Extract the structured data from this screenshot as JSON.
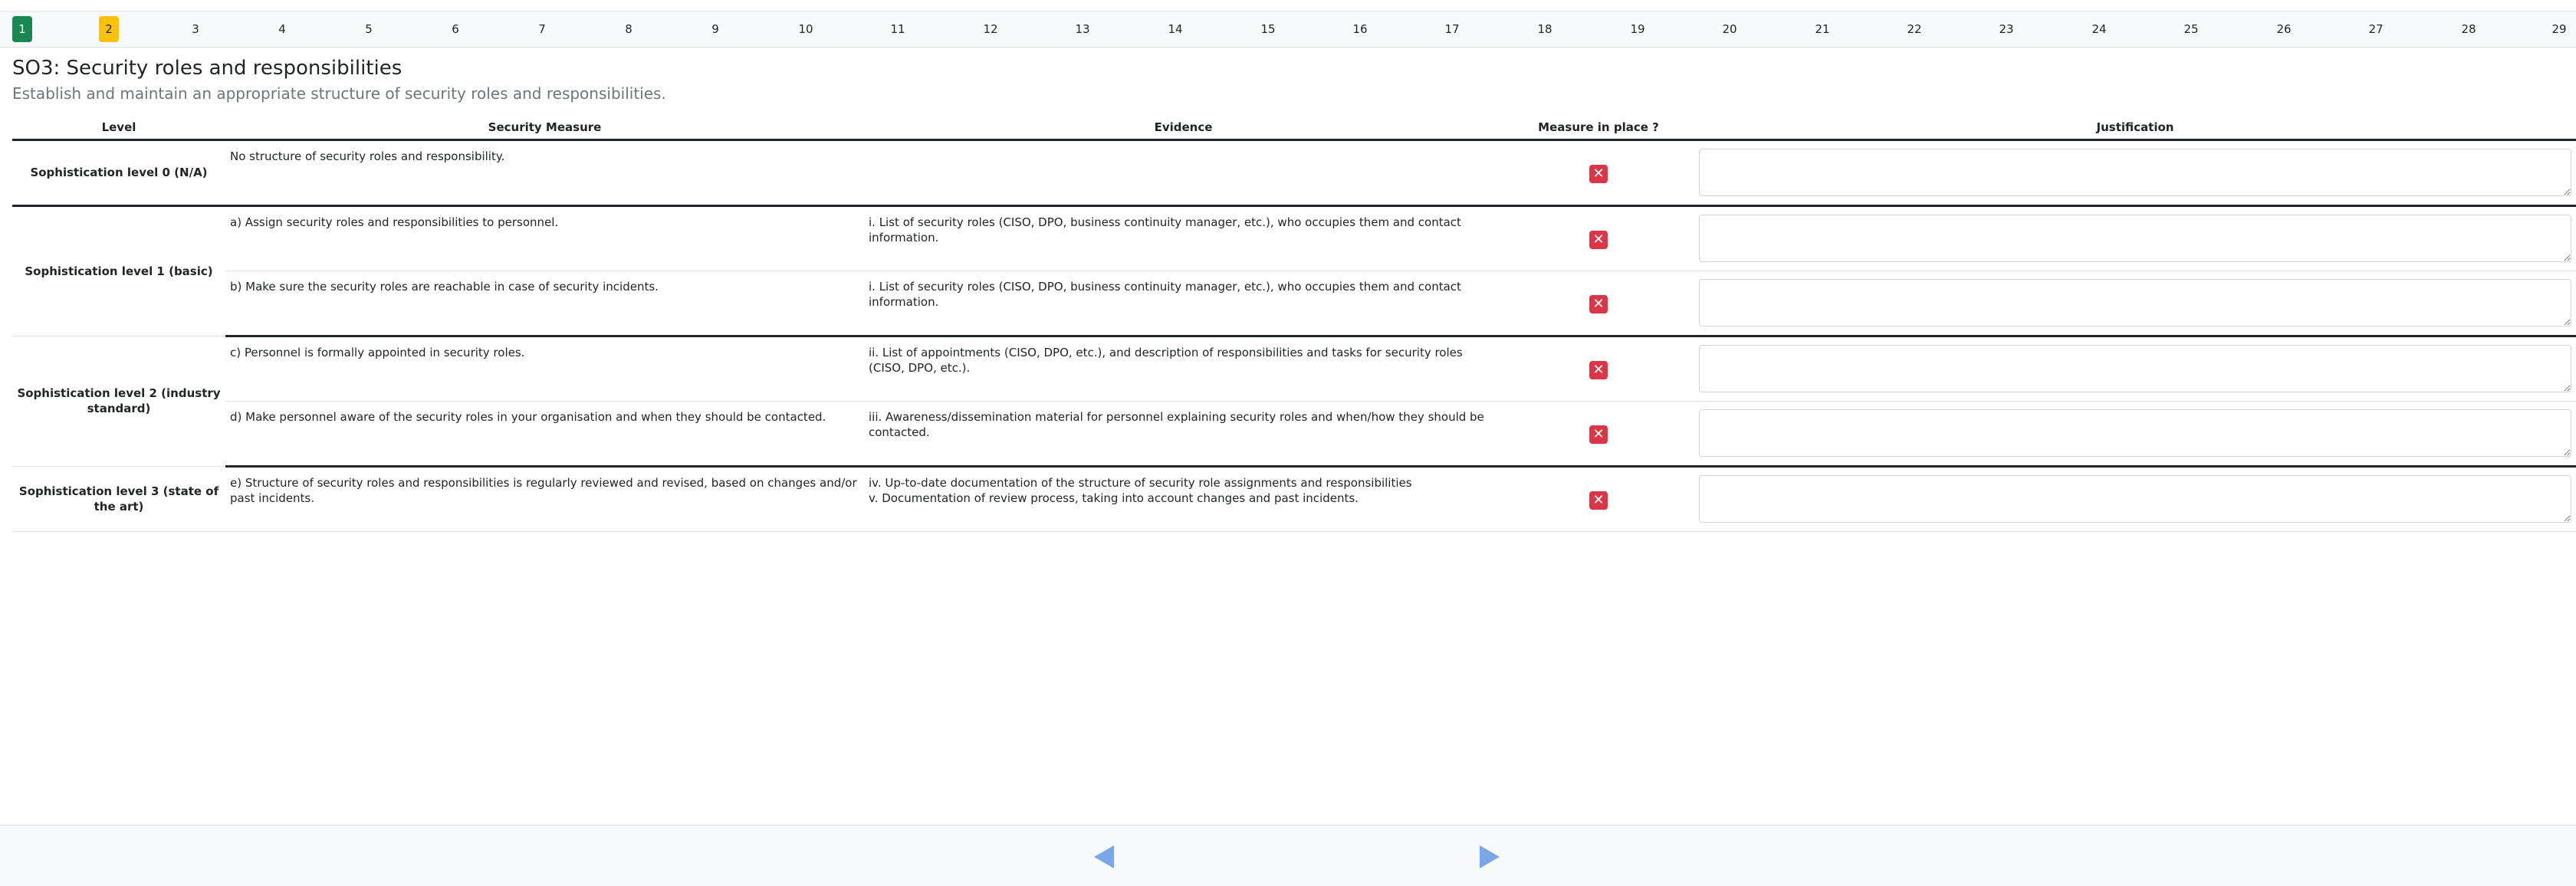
{
  "steps": {
    "items": [
      "1",
      "2",
      "3",
      "4",
      "5",
      "6",
      "7",
      "8",
      "9",
      "10",
      "11",
      "12",
      "13",
      "14",
      "15",
      "16",
      "17",
      "18",
      "19",
      "20",
      "21",
      "22",
      "23",
      "24",
      "25",
      "26",
      "27",
      "28",
      "29"
    ],
    "done_index": 0,
    "current_index": 1
  },
  "header": {
    "title": "SO3: Security roles and responsibilities",
    "subtitle": "Establish and maintain an appropriate structure of security roles and responsibilities."
  },
  "table": {
    "columns": {
      "level": "Level",
      "measure": "Security Measure",
      "evidence": "Evidence",
      "in_place": "Measure in place ?",
      "justification": "Justification"
    },
    "levels": [
      "Sophistication level 0 (N/A)",
      "Sophistication level 1 (basic)",
      "Sophistication level 2 (industry standard)",
      "Sophistication level 3 (state of the art)"
    ],
    "rows": [
      {
        "measure": "No structure of security roles and responsibility.",
        "evidence": [
          "",
          ""
        ]
      },
      {
        "measure": "a) Assign security roles and responsibilities to personnel.",
        "evidence": [
          "i. List of security roles (CISO, DPO, business continuity manager, etc.), who occupies them and contact information.",
          ""
        ]
      },
      {
        "measure": "b) Make sure the security roles are reachable in case of security incidents.",
        "evidence": [
          "i. List of security roles (CISO, DPO, business continuity manager, etc.), who occupies them and contact information.",
          ""
        ]
      },
      {
        "measure": "c) Personnel is formally appointed in security roles.",
        "evidence": [
          "ii. List of appointments (CISO, DPO, etc.), and description of responsibilities and tasks for security roles (CISO, DPO, etc.).",
          ""
        ]
      },
      {
        "measure": "d) Make personnel aware of the security roles in your organisation and when they should be contacted.",
        "evidence": [
          "iii. Awareness/dissemination material for personnel explaining security roles and when/how they should be contacted.",
          ""
        ]
      },
      {
        "measure": "e) Structure of security roles and responsibilities is regularly reviewed and revised, based on changes and/or past incidents.",
        "evidence": [
          "iv. Up-to-date documentation of the structure of security role assignments and responsibilities",
          "v. Documentation of review process, taking into account changes and past incidents."
        ]
      }
    ],
    "in_place_state": "no",
    "in_place_icon": "x-mark-icon",
    "justification_value": ""
  },
  "footer": {
    "prev_icon": "triangle-left-icon",
    "next_icon": "triangle-right-icon",
    "arrow_color": "#7aa7e8"
  },
  "colors": {
    "step_done": "#198754",
    "step_current": "#ffc107",
    "not_in_place": "#dc3545"
  }
}
